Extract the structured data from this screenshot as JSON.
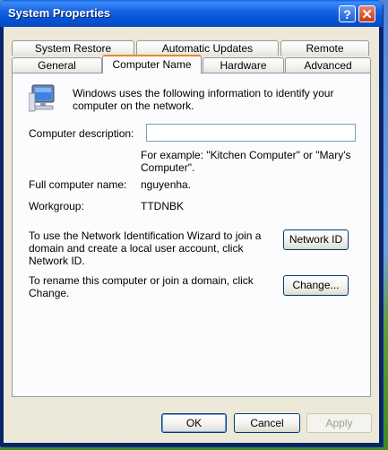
{
  "window": {
    "title": "System Properties",
    "help_glyph": "?",
    "close_glyph": "✕"
  },
  "tabs": {
    "row_back": [
      "System Restore",
      "Automatic Updates",
      "Remote"
    ],
    "row_front": [
      "General",
      "Computer Name",
      "Hardware",
      "Advanced"
    ],
    "selected": "Computer Name"
  },
  "panel": {
    "intro": "Windows uses the following information to identify your computer on the network.",
    "description_label": "Computer description:",
    "description_value": "",
    "example_text": "For example: \"Kitchen Computer\" or \"Mary's Computer\".",
    "full_name_label": "Full computer name:",
    "full_name_value": "nguyenha.",
    "workgroup_label": "Workgroup:",
    "workgroup_value": "TTDNBK",
    "network_id_text": "To use the Network Identification Wizard to join a domain and create a local user account, click Network ID.",
    "network_id_button": "Network ID",
    "rename_text": "To rename this computer or join a domain, click Change.",
    "change_button": "Change..."
  },
  "footer": {
    "ok": "OK",
    "cancel": "Cancel",
    "apply": "Apply"
  },
  "colors": {
    "titlebar": "#0454d6",
    "dialog_bg": "#ece9d8",
    "selected_tab_accent": "#e68b2c"
  }
}
